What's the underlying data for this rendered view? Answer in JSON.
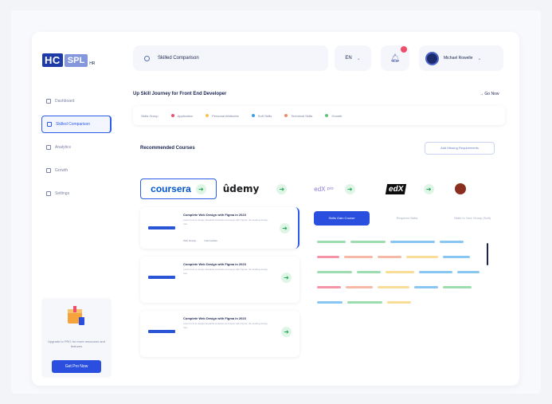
{
  "logo": {
    "mark": "HC",
    "mark2": "SPL",
    "sub": "HR"
  },
  "sidebar": {
    "items": [
      {
        "label": "Dashboard",
        "active": false
      },
      {
        "label": "Skilled Comparison",
        "active": true
      },
      {
        "label": "Analytics",
        "active": false
      },
      {
        "label": "Growth",
        "active": false
      },
      {
        "label": "Settings",
        "active": false
      }
    ]
  },
  "promo": {
    "text": "Upgrade to PRO for more resources and features",
    "button": "Get Pro Now"
  },
  "search": {
    "value": "Skilled Comparison"
  },
  "lang": {
    "value": "EN"
  },
  "user": {
    "name": "Michael Rowelle"
  },
  "journey": {
    "title": "Up Skill Journey for Front End Developer",
    "go_now": "Go Now",
    "label": "Skills Group",
    "legend": [
      {
        "label": "Application",
        "color": "#ef4d6b"
      },
      {
        "label": "Personal Attributes",
        "color": "#f5c44f"
      },
      {
        "label": "Soft Skills",
        "color": "#3aa0e8"
      },
      {
        "label": "Technical Skills",
        "color": "#f08a6a"
      },
      {
        "label": "Growth",
        "color": "#5cc57a"
      }
    ]
  },
  "recommended": {
    "title": "Recommended Courses",
    "button": "Add Missing Requirements"
  },
  "providers": {
    "coursera": "coursera",
    "udemy": "ûdemy",
    "edx": "edX ᵖʳᵒ",
    "edx2": "edX"
  },
  "cards": [
    {
      "title": "Complete Web Design with Figma in 2023",
      "desc": "Learn how to design beautiful websites and apps with Figma, the leading design tool.",
      "meta1": "Web Design",
      "meta2": "Intermediate"
    },
    {
      "title": "Complete Web Design with Figma in 2023",
      "desc": "Learn how to design beautiful websites and apps with Figma, the leading design tool.",
      "meta1": "",
      "meta2": ""
    },
    {
      "title": "Complete Web Design with Figma in 2023",
      "desc": "Learn how to design beautiful websites and apps with Figma, the leading design tool.",
      "meta1": "",
      "meta2": ""
    }
  ],
  "tabs": [
    {
      "label": "Skills Gain Course",
      "active": true
    },
    {
      "label": "Required Skills",
      "active": false
    },
    {
      "label": "Skills In Your Group (Soft)",
      "active": false
    }
  ],
  "skill_pills": [
    {
      "color": "#5cc57a",
      "w": 0
    },
    {
      "color": "#5cc57a",
      "w": 0
    },
    {
      "color": "#3aa0e8",
      "w": 0
    },
    {
      "color": "#3aa0e8",
      "w": 0
    },
    {
      "color": "#ef4d6b",
      "w": 0
    },
    {
      "color": "#f08a6a",
      "w": 0
    },
    {
      "color": "#f08a6a",
      "w": 0
    },
    {
      "color": "#f5c44f",
      "w": 0
    },
    {
      "color": "#3aa0e8",
      "w": 0
    },
    {
      "color": "#5cc57a",
      "w": 0
    },
    {
      "color": "#5cc57a",
      "w": 0
    },
    {
      "color": "#f5c44f",
      "w": 0
    },
    {
      "color": "#3aa0e8",
      "w": 0
    },
    {
      "color": "#3aa0e8",
      "w": 0
    },
    {
      "color": "#ef4d6b",
      "w": 0
    },
    {
      "color": "#f08a6a",
      "w": 0
    },
    {
      "color": "#f5c44f",
      "w": 0
    },
    {
      "color": "#3aa0e8",
      "w": 0
    },
    {
      "color": "#5cc57a",
      "w": 0
    },
    {
      "color": "#3aa0e8",
      "w": 0
    },
    {
      "color": "#5cc57a",
      "w": 0
    },
    {
      "color": "#f5c44f",
      "w": 0
    }
  ]
}
